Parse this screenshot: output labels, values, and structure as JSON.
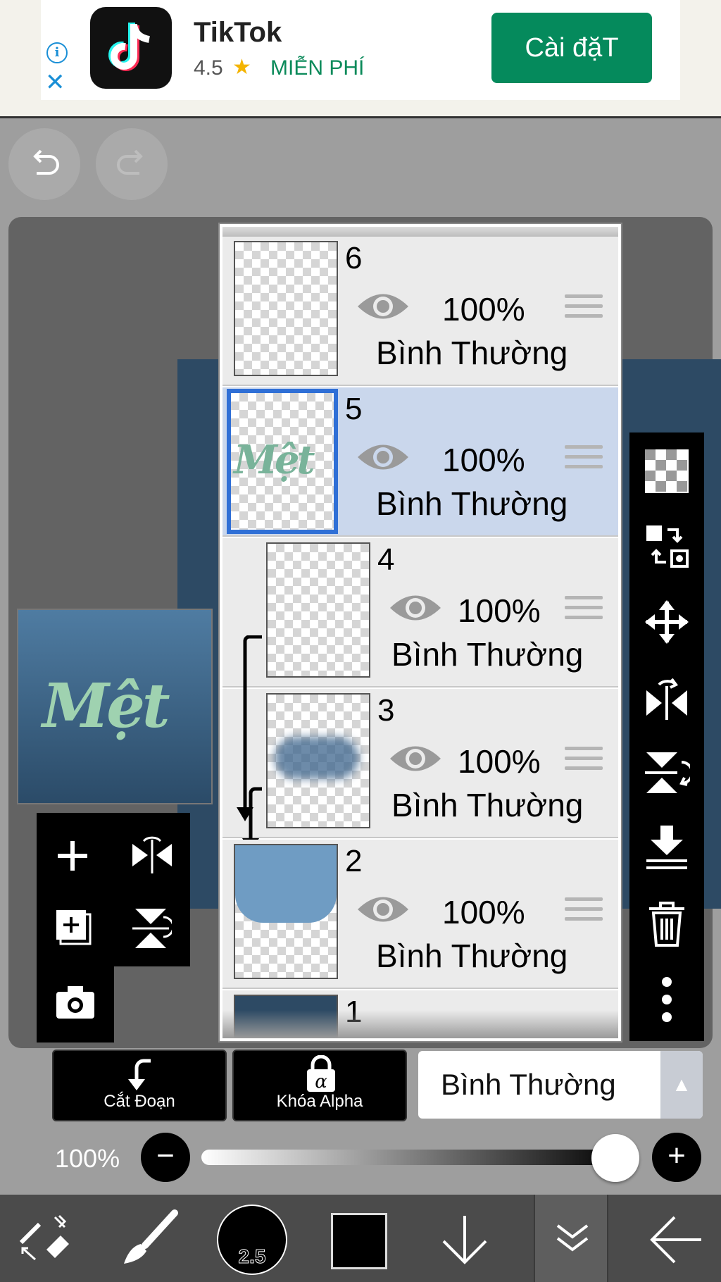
{
  "ad": {
    "app_name": "TikTok",
    "rating": "4.5",
    "price": "MIỄN PHÍ",
    "install_label": "Cài đặT",
    "info_glyph": "i",
    "close_glyph": "✕",
    "star_glyph": "★"
  },
  "artwork": {
    "preview_text": "Mệt"
  },
  "layers": [
    {
      "number": "6",
      "opacity": "100%",
      "blend": "Bình Thường",
      "selected": false,
      "clipped": false
    },
    {
      "number": "5",
      "opacity": "100%",
      "blend": "Bình Thường",
      "selected": true,
      "clipped": false,
      "thumb_text": "Mệt"
    },
    {
      "number": "4",
      "opacity": "100%",
      "blend": "Bình Thường",
      "selected": false,
      "clipped": true
    },
    {
      "number": "3",
      "opacity": "100%",
      "blend": "Bình Thường",
      "selected": false,
      "clipped": true
    },
    {
      "number": "2",
      "opacity": "100%",
      "blend": "Bình Thường",
      "selected": false,
      "clipped": false
    },
    {
      "number": "1",
      "opacity": "",
      "blend": "",
      "selected": false,
      "clipped": false
    }
  ],
  "controls": {
    "clip_label": "Cắt Đoạn",
    "alpha_lock_label": "Khóa Alpha",
    "blend_mode": "Bình Thường",
    "opacity_label": "100%",
    "opacity_value": 1.0
  },
  "bottom_nav": {
    "brush_size": "2.5",
    "color": "#000000"
  },
  "colors": {
    "selected_layer_bg": "#cad7ec",
    "selected_border": "#2f6fd6",
    "install_button": "#058a5c"
  },
  "icons": {
    "right_toolbar": [
      "transparency-icon",
      "transfer-icon",
      "move-icon",
      "flip-horizontal-icon",
      "flip-vertical-icon",
      "merge-down-icon",
      "trash-icon",
      "more-vertical-icon"
    ],
    "left_toolbox": [
      "add-layer-icon",
      "flip-icon",
      "add-copy-icon",
      "rotate-icon",
      "camera-icon"
    ]
  }
}
